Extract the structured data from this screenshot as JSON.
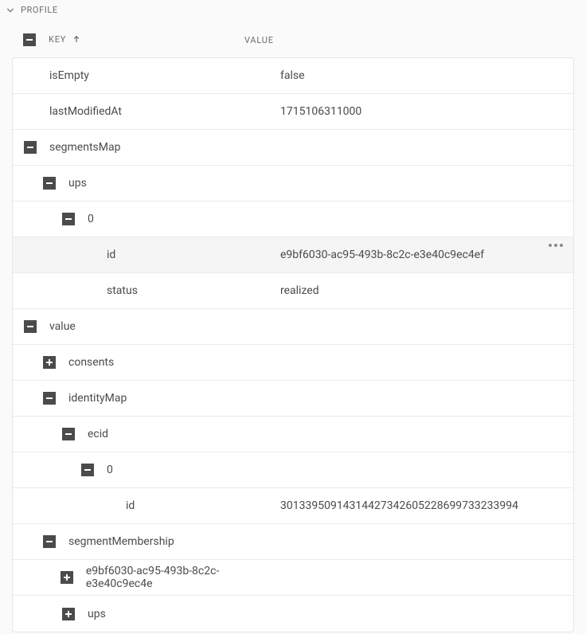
{
  "panel": {
    "title": "PROFILE"
  },
  "headers": {
    "key": "KEY",
    "value": "VALUE"
  },
  "rows": {
    "isEmpty": {
      "key": "isEmpty",
      "value": "false"
    },
    "lastModifiedAt": {
      "key": "lastModifiedAt",
      "value": "1715106311000"
    },
    "segmentsMap": {
      "key": "segmentsMap"
    },
    "ups": {
      "key": "ups"
    },
    "upsZero": {
      "key": "0"
    },
    "upsId": {
      "key": "id",
      "value": "e9bf6030-ac95-493b-8c2c-e3e40c9ec4ef"
    },
    "upsStatus": {
      "key": "status",
      "value": "realized"
    },
    "value": {
      "key": "value"
    },
    "consents": {
      "key": "consents"
    },
    "identityMap": {
      "key": "identityMap"
    },
    "ecid": {
      "key": "ecid"
    },
    "ecidZero": {
      "key": "0"
    },
    "ecidId": {
      "key": "id",
      "value": "30133950914314427342605228699733233994"
    },
    "segmentMembership": {
      "key": "segmentMembership"
    },
    "segMemberGuid": {
      "key": "e9bf6030-ac95-493b-8c2c-e3e40c9ec4e"
    },
    "segMemberUps": {
      "key": "ups"
    }
  }
}
